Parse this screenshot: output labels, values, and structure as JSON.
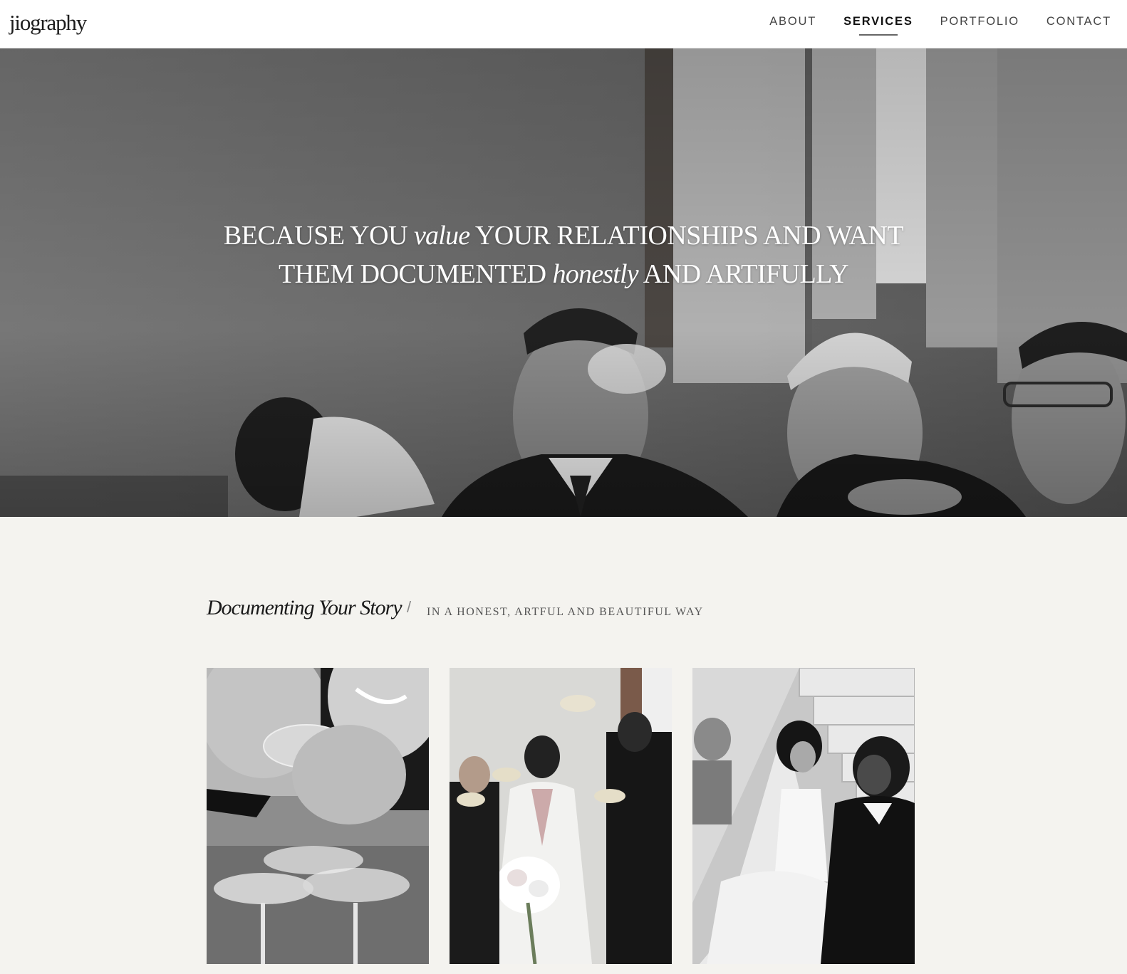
{
  "header": {
    "logo": "jiography",
    "nav": [
      {
        "label": "ABOUT"
      },
      {
        "label": "SERVICES",
        "active": true
      },
      {
        "label": "PORTFOLIO"
      },
      {
        "label": "CONTACT"
      }
    ]
  },
  "hero": {
    "line1_pre": "BECAUSE YOU",
    "line1_em": "value",
    "line1_post": "YOUR RELATIONSHIPS AND WANT",
    "line2_pre": "THEM DOCUMENTED",
    "line2_em": "honestly",
    "line2_post": "AND ARTIFULLY",
    "image": "black-and-white-wedding-toast-photo"
  },
  "story": {
    "title": "Documenting Your Story",
    "separator": "/",
    "subtitle": "IN A HONEST, ARTFUL AND BEAUTIFUL WAY",
    "photos": [
      {
        "subject": "couple-sipping-champagne-photo"
      },
      {
        "subject": "bride-toasting-guests-photo"
      },
      {
        "subject": "couple-on-staircase-photo"
      }
    ]
  },
  "colors": {
    "header_bg": "#ffffff",
    "page_bg": "#f4f3ef",
    "text_dark": "#1a1a1a",
    "nav_underline": "#666666"
  }
}
